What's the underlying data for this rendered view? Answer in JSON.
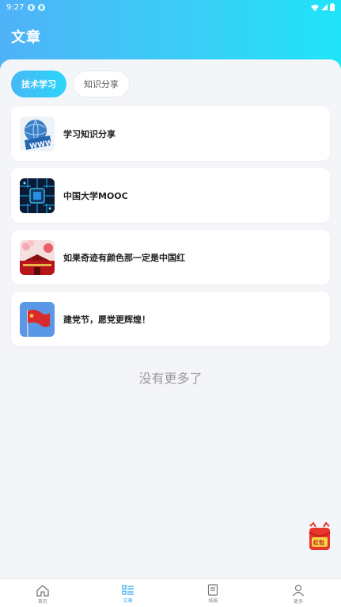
{
  "status": {
    "time": "9:27"
  },
  "header": {
    "title": "文章"
  },
  "tabs": [
    {
      "label": "技术学习",
      "active": true
    },
    {
      "label": "知识分享",
      "active": false
    }
  ],
  "articles": [
    {
      "title": "学习知识分享",
      "icon": "www-globe-image"
    },
    {
      "title": "中国大学MOOC",
      "icon": "circuit-chip-image"
    },
    {
      "title": "如果奇迹有颜色那一定是中国红",
      "icon": "tiananmen-image"
    },
    {
      "title": "建党节，愿党更辉煌！",
      "icon": "flag-image"
    }
  ],
  "empty_text": "没有更多了",
  "red_packet": {
    "label": "红包"
  },
  "bottom_nav": [
    {
      "label": "首页",
      "icon": "home-icon",
      "active": false
    },
    {
      "label": "文章",
      "icon": "list-icon",
      "active": true
    },
    {
      "label": "线报",
      "icon": "document-icon",
      "active": false
    },
    {
      "label": "更多",
      "icon": "user-icon",
      "active": false
    }
  ],
  "colors": {
    "header_gradient_start": "#4fb2f7",
    "header_gradient_end": "#1fe4f8",
    "accent": "#2aa6f2",
    "background": "#f4f5f9"
  }
}
